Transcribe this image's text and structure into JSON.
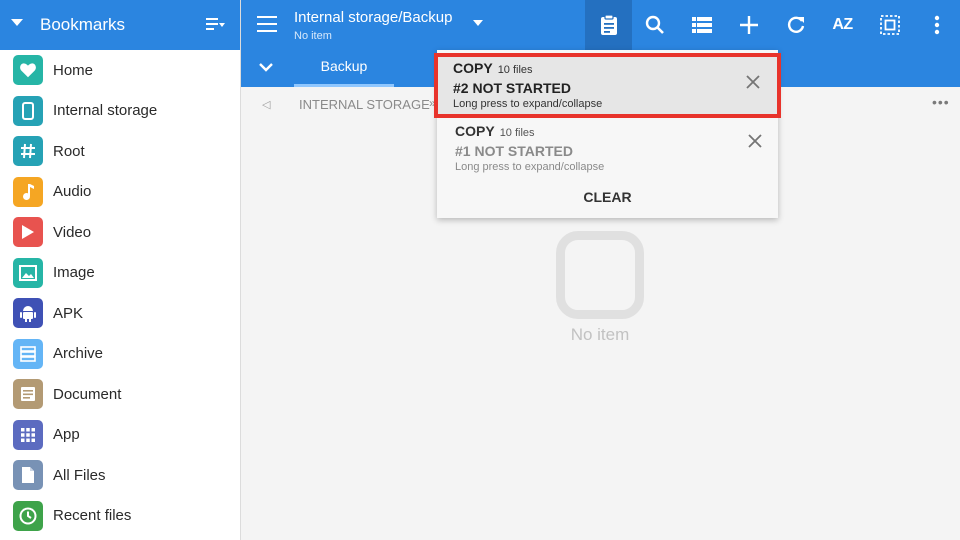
{
  "sidebar": {
    "title": "Bookmarks",
    "items": [
      {
        "label": "Home",
        "icon": "heart-icon",
        "color": "#26b5a6"
      },
      {
        "label": "Internal storage",
        "icon": "phone-icon",
        "color": "#26a2b5"
      },
      {
        "label": "Root",
        "icon": "hash-icon",
        "color": "#26a2b5"
      },
      {
        "label": "Audio",
        "icon": "music-note-icon",
        "color": "#f5a623"
      },
      {
        "label": "Video",
        "icon": "play-icon",
        "color": "#e8534f"
      },
      {
        "label": "Image",
        "icon": "image-icon",
        "color": "#26b5a6"
      },
      {
        "label": "APK",
        "icon": "android-icon",
        "color": "#3f51b5"
      },
      {
        "label": "Archive",
        "icon": "archive-icon",
        "color": "#64b5f6"
      },
      {
        "label": "Document",
        "icon": "document-icon",
        "color": "#b39a74"
      },
      {
        "label": "App",
        "icon": "apps-grid-icon",
        "color": "#5c6bc0"
      },
      {
        "label": "All Files",
        "icon": "file-icon",
        "color": "#7892b5"
      },
      {
        "label": "Recent files",
        "icon": "clock-icon",
        "color": "#3ea34a"
      }
    ]
  },
  "topbar": {
    "title": "Internal storage/Backup",
    "subtitle": "No item",
    "sort_label": "AZ"
  },
  "tabs": [
    {
      "label": "Backup"
    }
  ],
  "breadcrumb": {
    "path": "INTERNAL STORAGE",
    "separator": "»"
  },
  "empty": {
    "text": "No item"
  },
  "operations": {
    "items": [
      {
        "type": "COPY",
        "count": "10 files",
        "status": "#2  NOT STARTED",
        "hint": "Long press to expand/collapse"
      },
      {
        "type": "COPY",
        "count": "10 files",
        "status": "#1  NOT STARTED",
        "hint": "Long press to expand/collapse"
      }
    ],
    "clear_label": "CLEAR"
  },
  "colors": {
    "primary": "#2b85e0",
    "highlight": "#e8332b"
  }
}
